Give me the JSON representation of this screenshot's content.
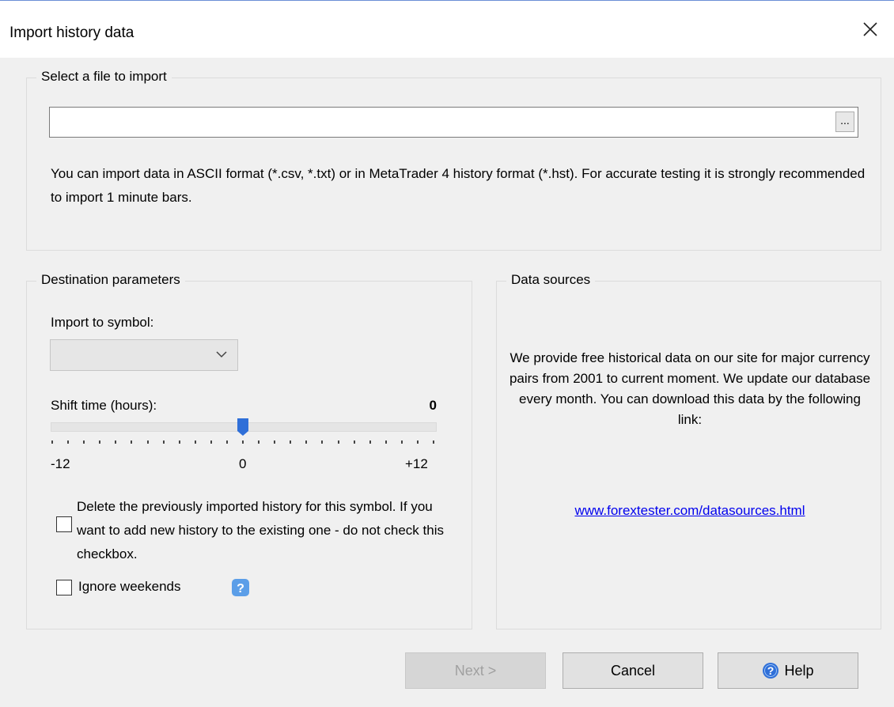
{
  "window": {
    "title": "Import history data",
    "close_icon": "close-icon"
  },
  "file_group": {
    "legend": "Select a file to import",
    "file_value": "",
    "browse_label": "...",
    "info": "You can import data in ASCII format (*.csv, *.txt) or in MetaTrader 4 history format (*.hst). For accurate testing it is strongly recommended to import 1 minute bars."
  },
  "destination": {
    "legend": "Destination parameters",
    "symbol_label": "Import to symbol:",
    "symbol_value": "",
    "shift_label": "Shift time (hours):",
    "shift_value": "0",
    "shift_min": "-12",
    "shift_mid": "0",
    "shift_max": "+12",
    "slider": {
      "min": -12,
      "max": 12,
      "value": 0
    },
    "delete_history_label": "Delete the previously imported history for this symbol. If you want to add new history to the existing one - do not check this  checkbox.",
    "delete_history_checked": false,
    "ignore_weekends_label": "Ignore weekends",
    "ignore_weekends_checked": false
  },
  "data_sources": {
    "legend": "Data sources",
    "text": "We provide free historical data on our site for major currency pairs from 2001 to current moment. We update our database every month. You can download this data by the following link:",
    "link": "www.forextester.com/datasources.html"
  },
  "buttons": {
    "next": "Next >",
    "cancel": "Cancel",
    "help": "Help"
  },
  "colors": {
    "accent": "#2f6fd8",
    "link": "#0000ee",
    "background": "#f0f0f0"
  }
}
